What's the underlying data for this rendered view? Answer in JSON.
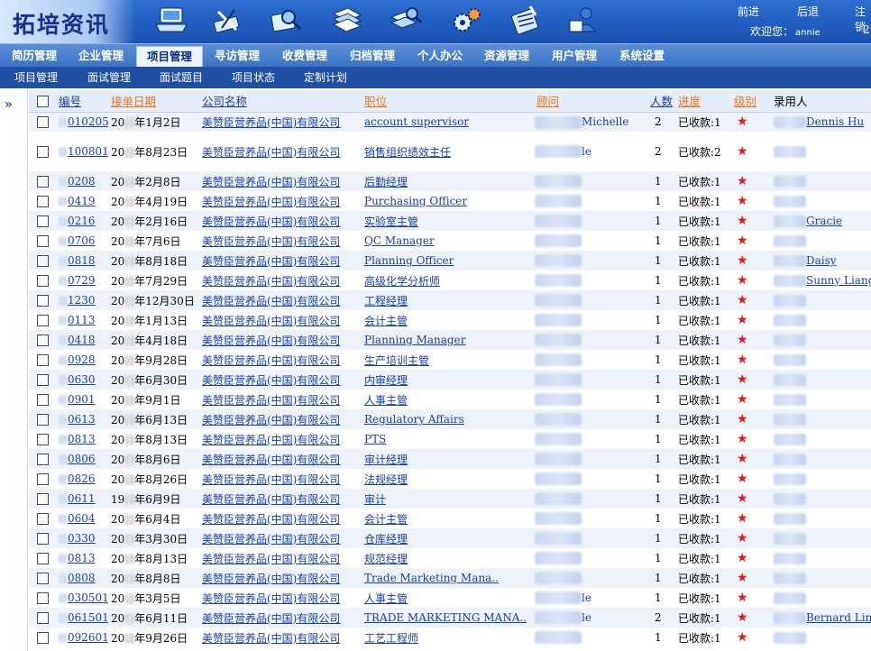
{
  "app": {
    "title": "拓培资讯",
    "links": {
      "forward": "前进",
      "back": "后退",
      "logout": "注销"
    },
    "welcome": "欢迎您：",
    "username": "annie",
    "header_number": "2"
  },
  "toolbar_icons": [
    "laptop-icon",
    "tools-icon",
    "magnifier-icon",
    "books-icon",
    "search-books-icon",
    "gears-icon",
    "calculator-icon",
    "users-icon"
  ],
  "main_nav": [
    {
      "label": "简历管理",
      "active": false
    },
    {
      "label": "企业管理",
      "active": false
    },
    {
      "label": "项目管理",
      "active": true
    },
    {
      "label": "寻访管理",
      "active": false
    },
    {
      "label": "收费管理",
      "active": false
    },
    {
      "label": "归档管理",
      "active": false
    },
    {
      "label": "个人办公",
      "active": false
    },
    {
      "label": "资源管理",
      "active": false
    },
    {
      "label": "用户管理",
      "active": false
    },
    {
      "label": "系统设置",
      "active": false
    }
  ],
  "sub_nav": [
    "项目管理",
    "面试管理",
    "面试题目",
    "项目状态",
    "定制计划"
  ],
  "table": {
    "headers": {
      "id": "编号",
      "date": "接单日期",
      "company": "公司名称",
      "position": "职位",
      "consultant": "顾问",
      "count": "人数",
      "progress": "进度",
      "level": "级别",
      "hired": "录用人"
    },
    "rows": [
      {
        "id": "010205",
        "date_prefix": "20",
        "date": "年1月2日",
        "company": "美赞臣营养品(中国)有限公司",
        "position": "account supervisor",
        "consultant": "Michelle",
        "count": "2",
        "progress": "已收款:1",
        "hired": "Dennis Hu",
        "tall": false
      },
      {
        "id": "100801",
        "date_prefix": "20",
        "date": "年8月23日",
        "company": "美赞臣营养品(中国)有限公司",
        "position": "销售组织绩效主任",
        "consultant": "le",
        "count": "2",
        "progress": "已收款:2",
        "hired": "",
        "tall": true
      },
      {
        "id": "0208",
        "date_prefix": "20",
        "date": "年2月8日",
        "company": "美赞臣营养品(中国)有限公司",
        "position": "后勤经理",
        "consultant": "",
        "count": "1",
        "progress": "已收款:1",
        "hired": "",
        "tall": false
      },
      {
        "id": "0419",
        "date_prefix": "20",
        "date": "年4月19日",
        "company": "美赞臣营养品(中国)有限公司",
        "position": "Purchasing Officer",
        "consultant": "",
        "count": "1",
        "progress": "已收款:1",
        "hired": "",
        "tall": false
      },
      {
        "id": "0216",
        "date_prefix": "20",
        "date": "年2月16日",
        "company": "美赞臣营养品(中国)有限公司",
        "position": "实验室主管",
        "consultant": "",
        "count": "1",
        "progress": "已收款:1",
        "hired": "Gracie",
        "tall": false
      },
      {
        "id": "0706",
        "date_prefix": "20",
        "date": "年7月6日",
        "company": "美赞臣营养品(中国)有限公司",
        "position": "QC Manager",
        "consultant": "",
        "count": "1",
        "progress": "已收款:1",
        "hired": "",
        "tall": false
      },
      {
        "id": "0818",
        "date_prefix": "20",
        "date": "年8月18日",
        "company": "美赞臣营养品(中国)有限公司",
        "position": "Planning Officer",
        "consultant": "",
        "count": "1",
        "progress": "已收款:1",
        "hired": "Daisy",
        "tall": false
      },
      {
        "id": "0729",
        "date_prefix": "20",
        "date": "年7月29日",
        "company": "美赞臣营养品(中国)有限公司",
        "position": "高级化学分析师",
        "consultant": "",
        "count": "1",
        "progress": "已收款:1",
        "hired": "Sunny Liang",
        "tall": false
      },
      {
        "id": "1230",
        "date_prefix": "20",
        "date": "年12月30日",
        "company": "美赞臣营养品(中国)有限公司",
        "position": "工程经理",
        "consultant": "",
        "count": "1",
        "progress": "已收款:1",
        "hired": "",
        "tall": false
      },
      {
        "id": "0113",
        "date_prefix": "20",
        "date": "年1月13日",
        "company": "美赞臣营养品(中国)有限公司",
        "position": "会计主管",
        "consultant": "",
        "count": "1",
        "progress": "已收款:1",
        "hired": "",
        "tall": false
      },
      {
        "id": "0418",
        "date_prefix": "20",
        "date": "年4月18日",
        "company": "美赞臣营养品(中国)有限公司",
        "position": "Planning Manager",
        "consultant": "",
        "count": "1",
        "progress": "已收款:1",
        "hired": "",
        "tall": false
      },
      {
        "id": "0928",
        "date_prefix": "20",
        "date": "年9月28日",
        "company": "美赞臣营养品(中国)有限公司",
        "position": "生产培训主管",
        "consultant": "",
        "count": "1",
        "progress": "已收款:1",
        "hired": "",
        "tall": false
      },
      {
        "id": "0630",
        "date_prefix": "20",
        "date": "年6月30日",
        "company": "美赞臣营养品(中国)有限公司",
        "position": "内审经理",
        "consultant": "",
        "count": "1",
        "progress": "已收款:1",
        "hired": "",
        "tall": false
      },
      {
        "id": "0901",
        "date_prefix": "20",
        "date": "年9月1日",
        "company": "美赞臣营养品(中国)有限公司",
        "position": "人事主管",
        "consultant": "",
        "count": "1",
        "progress": "已收款:1",
        "hired": "",
        "tall": false
      },
      {
        "id": "0613",
        "date_prefix": "20",
        "date": "年6月13日",
        "company": "美赞臣营养品(中国)有限公司",
        "position": "Regulatory Affairs",
        "consultant": "",
        "count": "1",
        "progress": "已收款:1",
        "hired": "",
        "tall": false
      },
      {
        "id": "0813",
        "date_prefix": "20",
        "date": "年8月13日",
        "company": "美赞臣营养品(中国)有限公司",
        "position": "PTS",
        "consultant": "",
        "count": "1",
        "progress": "已收款:1",
        "hired": "",
        "tall": false
      },
      {
        "id": "0806",
        "date_prefix": "20",
        "date": "年8月6日",
        "company": "美赞臣营养品(中国)有限公司",
        "position": "审计经理",
        "consultant": "",
        "count": "1",
        "progress": "已收款:1",
        "hired": "",
        "tall": false
      },
      {
        "id": "0826",
        "date_prefix": "20",
        "date": "年8月26日",
        "company": "美赞臣营养品(中国)有限公司",
        "position": "法规经理",
        "consultant": "",
        "count": "1",
        "progress": "已收款:1",
        "hired": "",
        "tall": false
      },
      {
        "id": "0611",
        "date_prefix": "19",
        "date": "年6月9日",
        "company": "美赞臣营养品(中国)有限公司",
        "position": "审计",
        "consultant": "",
        "count": "1",
        "progress": "已收款:1",
        "hired": "",
        "tall": false
      },
      {
        "id": "0604",
        "date_prefix": "20",
        "date": "年6月4日",
        "company": "美赞臣营养品(中国)有限公司",
        "position": "会计主管",
        "consultant": "",
        "count": "1",
        "progress": "已收款:1",
        "hired": "",
        "tall": false
      },
      {
        "id": "0330",
        "date_prefix": "20",
        "date": "年3月30日",
        "company": "美赞臣营养品(中国)有限公司",
        "position": "仓库经理",
        "consultant": "",
        "count": "1",
        "progress": "已收款:1",
        "hired": "",
        "tall": false
      },
      {
        "id": "0813",
        "date_prefix": "20",
        "date": "年8月13日",
        "company": "美赞臣营养品(中国)有限公司",
        "position": "规范经理",
        "consultant": "",
        "count": "1",
        "progress": "已收款:1",
        "hired": "",
        "tall": false
      },
      {
        "id": "0808",
        "date_prefix": "20",
        "date": "年8月8日",
        "company": "美赞臣营养品(中国)有限公司",
        "position": "Trade Marketing Mana..",
        "consultant": "",
        "count": "1",
        "progress": "已收款:1",
        "hired": "",
        "tall": false
      },
      {
        "id": "030501",
        "date_prefix": "20",
        "date": "年3月5日",
        "company": "美赞臣营养品(中国)有限公司",
        "position": "人事主管",
        "consultant": "le",
        "count": "1",
        "progress": "已收款:1",
        "hired": "",
        "tall": false
      },
      {
        "id": "061501",
        "date_prefix": "20",
        "date": "年6月11日",
        "company": "美赞臣营养品(中国)有限公司",
        "position": "TRADE MARKETING MANA..",
        "consultant": "le",
        "count": "2",
        "progress": "已收款:1",
        "hired": "Bernard Lin",
        "tall": false
      },
      {
        "id": "092601",
        "date_prefix": "20",
        "date": "年9月26日",
        "company": "美赞臣营养品(中国)有限公司",
        "position": "工艺工程师",
        "consultant": "",
        "count": "1",
        "progress": "已收款:1",
        "hired": "",
        "tall": false
      }
    ]
  },
  "colors": {
    "accent": "#2160c2",
    "nav": "#3c74c4",
    "subnav": "#1e4fa3",
    "link": "#1a3fb0",
    "star": "#e51b1b",
    "sort_orange": "#e8781d"
  }
}
